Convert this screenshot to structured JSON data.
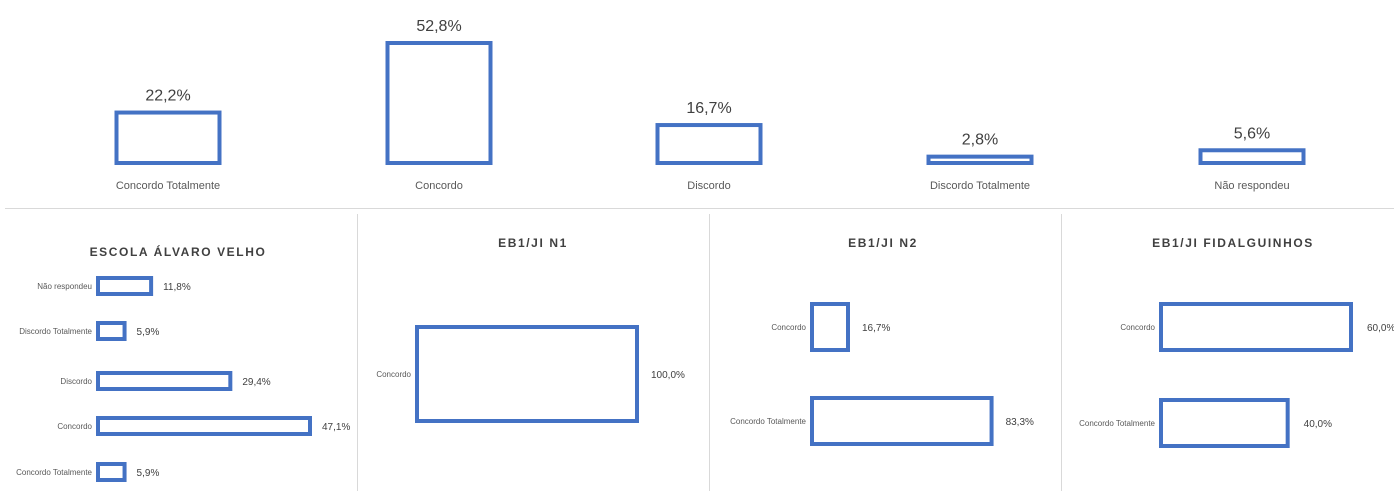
{
  "chart_data": [
    {
      "type": "bar",
      "categories": [
        "Concordo Totalmente",
        "Concordo",
        "Discordo",
        "Discordo Totalmente",
        "Não respondeu"
      ],
      "values": [
        22.2,
        52.8,
        16.7,
        2.8,
        5.6
      ],
      "value_labels": [
        "22,2%",
        "52,8%",
        "16,7%",
        "2,8%",
        "5,6%"
      ],
      "title": "",
      "xlabel": "",
      "ylabel": "",
      "orientation": "vertical",
      "color": "#4472c4",
      "grid": false
    },
    {
      "type": "bar",
      "title": "ESCOLA ÁLVARO VELHO",
      "orientation": "horizontal",
      "categories": [
        "Não respondeu",
        "Discordo Totalmente",
        "Discordo",
        "Concordo",
        "Concordo Totalmente"
      ],
      "values": [
        11.8,
        5.9,
        29.4,
        47.1,
        5.9
      ],
      "value_labels": [
        "11,8%",
        "5,9%",
        "29,4%",
        "47,1%",
        "5,9%"
      ],
      "color": "#4472c4"
    },
    {
      "type": "bar",
      "title": "EB1/JI N1",
      "orientation": "horizontal",
      "categories": [
        "Concordo"
      ],
      "values": [
        100.0
      ],
      "value_labels": [
        "100,0%"
      ],
      "color": "#4472c4"
    },
    {
      "type": "bar",
      "title": "EB1/JI N2",
      "orientation": "horizontal",
      "categories": [
        "Concordo",
        "Concordo Totalmente"
      ],
      "values": [
        16.7,
        83.3
      ],
      "value_labels": [
        "16,7%",
        "83,3%"
      ],
      "color": "#5b9bd5"
    },
    {
      "type": "bar",
      "title": "EB1/JI FIDALGUINHOS",
      "orientation": "horizontal",
      "categories": [
        "Concordo",
        "Concordo Totalmente"
      ],
      "values": [
        60.0,
        40.0
      ],
      "value_labels": [
        "60,0%",
        "40,0%"
      ],
      "color": "#5b9bd5"
    }
  ]
}
